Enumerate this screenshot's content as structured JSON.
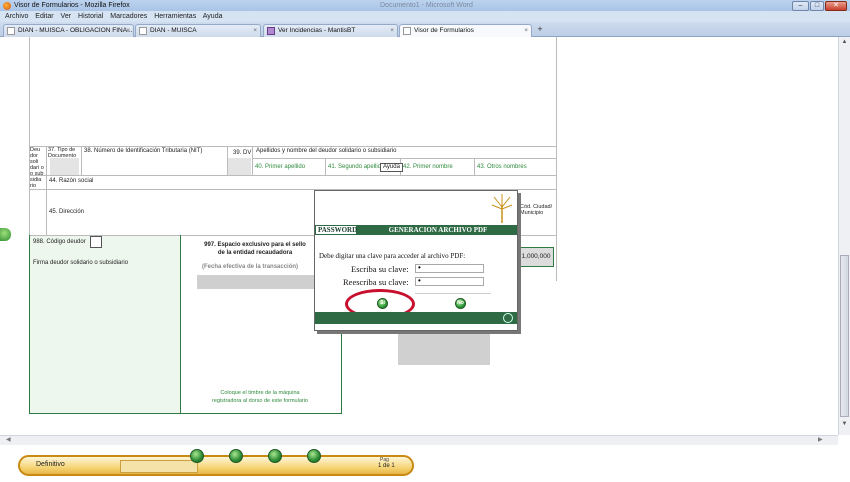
{
  "window": {
    "title": "Visor de Formularios - Mozilla Firefox",
    "bg_doc_title": "Documento1 - Microsoft Word",
    "controls": {
      "minimize": "–",
      "maximize": "□",
      "close": "✕"
    }
  },
  "menu": [
    "Archivo",
    "Editar",
    "Ver",
    "Historial",
    "Marcadores",
    "Herramientas",
    "Ayuda"
  ],
  "tabs": [
    {
      "label": "DIAN - MUISCA - OBLIGACION FINA...",
      "close": "×"
    },
    {
      "label": "DIAN - MUISCA",
      "close": "×"
    },
    {
      "label": "Ver Incidencias - MantisBT",
      "close": "×"
    },
    {
      "label": "Visor de Formularios",
      "close": "×",
      "active": true
    }
  ],
  "new_tab": "+",
  "form": {
    "deudor_side": "Deu dor soli dari o o sub sidia rio",
    "f37": "37. Tipo de Documento",
    "f38": "38. Número de Identificación Tributaria (NIT)",
    "f39": "39. DV",
    "apellidos": "Apellidos y nombre del deudor solidario o subsidiario",
    "f40": "40. Primer apellido",
    "f41": "41. Segundo apellido",
    "ayuda": "Ayuda",
    "f42": "42. Primer nombre",
    "f43": "43. Otros nombres",
    "f44": "44. Razón social",
    "f45": "45. Dirección",
    "cod_ciudad": "Cód. Ciudad/ Municipio",
    "f988": "988. Código deudor",
    "firma": "Firma deudor solidario o subsidiario",
    "f997_title": "997. Espacio exclusivo para el sello de la entidad recaudadora",
    "fecha": "(Fecha efectiva de la transacción)",
    "amount": "1,000,000",
    "timbre": "Coloque el timbre de la máquina registradora al dorso de este formulario"
  },
  "dialog": {
    "left_header": "PASSWORD",
    "header": "GENERACION ARCHIVO PDF",
    "instruction": "Debe digitar una clave para acceder al archivo PDF:",
    "clave_label": "Escriba su clave:",
    "clave_value": "•",
    "reescriba_label": "Reescriba su clave:",
    "reescriba_value": "•",
    "ok_label": "Si",
    "cancel_label": "No"
  },
  "status": {
    "mode": "Definitivo",
    "page_label": "Pag",
    "page_value": "1 de 1"
  },
  "colors": {
    "accent_green": "#2e6b45",
    "highlight_ring": "#c8102e",
    "pill_border": "#c88a10"
  }
}
